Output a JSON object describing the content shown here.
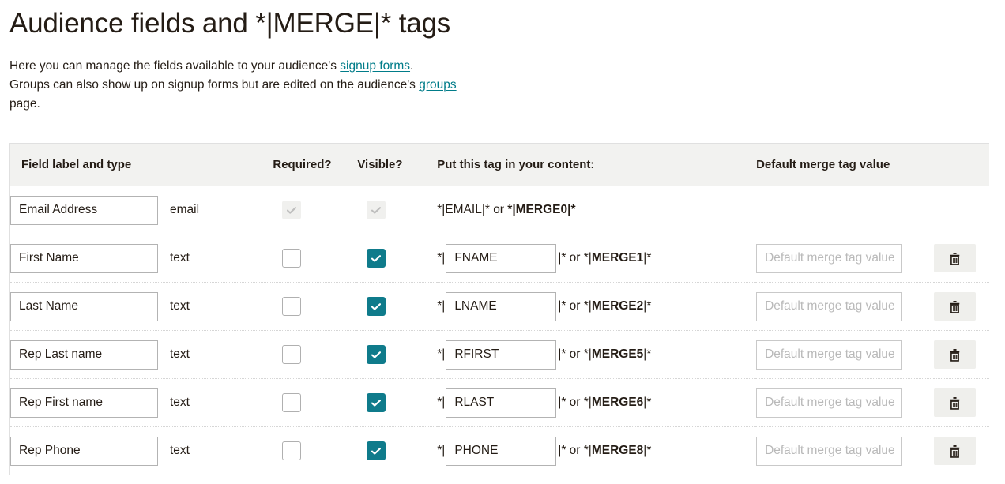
{
  "page": {
    "title": "Audience fields and *|MERGE|* tags",
    "intro": {
      "line1_pre": "Here you can manage the fields available to your audience's ",
      "link1": "signup forms",
      "line1_post": ".",
      "line2_pre": "Groups can also show up on signup forms but are edited on the audience's ",
      "link2": "groups",
      "line2_post": "",
      "line3": "page."
    }
  },
  "table": {
    "headers": {
      "label": "Field label and type",
      "required": "Required?",
      "visible": "Visible?",
      "tag": "Put this tag in your content:",
      "default": "Default merge tag value",
      "actions": ""
    },
    "default_placeholder": "Default merge tag value",
    "tag_prefix": "*|",
    "tag_suffix": "|* or *|",
    "tag_end": "|*",
    "rows": [
      {
        "label": "Email Address",
        "type": "email",
        "required": true,
        "required_locked": true,
        "visible": true,
        "visible_locked": true,
        "tag_editable": false,
        "tag_static_prefix": "*|EMAIL|* or *|",
        "tag_name": "EMAIL",
        "merge_tag": "MERGE0",
        "default_value": "",
        "deletable": false
      },
      {
        "label": "First Name",
        "type": "text",
        "required": false,
        "required_locked": false,
        "visible": true,
        "visible_locked": false,
        "tag_editable": true,
        "tag_name": "FNAME",
        "merge_tag": "MERGE1",
        "default_value": "",
        "deletable": true
      },
      {
        "label": "Last Name",
        "type": "text",
        "required": false,
        "required_locked": false,
        "visible": true,
        "visible_locked": false,
        "tag_editable": true,
        "tag_name": "LNAME",
        "merge_tag": "MERGE2",
        "default_value": "",
        "deletable": true
      },
      {
        "label": "Rep Last name",
        "type": "text",
        "required": false,
        "required_locked": false,
        "visible": true,
        "visible_locked": false,
        "tag_editable": true,
        "tag_name": "RFIRST",
        "merge_tag": "MERGE5",
        "default_value": "",
        "deletable": true
      },
      {
        "label": "Rep First name",
        "type": "text",
        "required": false,
        "required_locked": false,
        "visible": true,
        "visible_locked": false,
        "tag_editable": true,
        "tag_name": "RLAST",
        "merge_tag": "MERGE6",
        "default_value": "",
        "deletable": true
      },
      {
        "label": "Rep Phone",
        "type": "text",
        "required": false,
        "required_locked": false,
        "visible": true,
        "visible_locked": false,
        "tag_editable": true,
        "tag_name": "PHONE",
        "merge_tag": "MERGE8",
        "default_value": "",
        "deletable": true
      }
    ]
  },
  "icons": {
    "delete": "trash-icon",
    "check": "checkmark-icon"
  },
  "colors": {
    "accent_teal": "#0f7b8b",
    "link": "#007c89",
    "header_bg": "#f2f2f0",
    "button_bg": "#efefec",
    "text": "#241c15"
  }
}
